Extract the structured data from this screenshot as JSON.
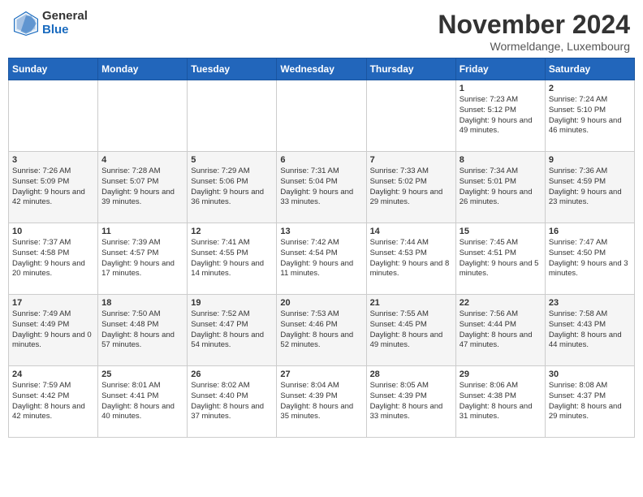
{
  "logo": {
    "general": "General",
    "blue": "Blue"
  },
  "header": {
    "month": "November 2024",
    "location": "Wormeldange, Luxembourg"
  },
  "days_of_week": [
    "Sunday",
    "Monday",
    "Tuesday",
    "Wednesday",
    "Thursday",
    "Friday",
    "Saturday"
  ],
  "weeks": [
    [
      {
        "day": "",
        "info": ""
      },
      {
        "day": "",
        "info": ""
      },
      {
        "day": "",
        "info": ""
      },
      {
        "day": "",
        "info": ""
      },
      {
        "day": "",
        "info": ""
      },
      {
        "day": "1",
        "info": "Sunrise: 7:23 AM\nSunset: 5:12 PM\nDaylight: 9 hours\nand 49 minutes."
      },
      {
        "day": "2",
        "info": "Sunrise: 7:24 AM\nSunset: 5:10 PM\nDaylight: 9 hours\nand 46 minutes."
      }
    ],
    [
      {
        "day": "3",
        "info": "Sunrise: 7:26 AM\nSunset: 5:09 PM\nDaylight: 9 hours\nand 42 minutes."
      },
      {
        "day": "4",
        "info": "Sunrise: 7:28 AM\nSunset: 5:07 PM\nDaylight: 9 hours\nand 39 minutes."
      },
      {
        "day": "5",
        "info": "Sunrise: 7:29 AM\nSunset: 5:06 PM\nDaylight: 9 hours\nand 36 minutes."
      },
      {
        "day": "6",
        "info": "Sunrise: 7:31 AM\nSunset: 5:04 PM\nDaylight: 9 hours\nand 33 minutes."
      },
      {
        "day": "7",
        "info": "Sunrise: 7:33 AM\nSunset: 5:02 PM\nDaylight: 9 hours\nand 29 minutes."
      },
      {
        "day": "8",
        "info": "Sunrise: 7:34 AM\nSunset: 5:01 PM\nDaylight: 9 hours\nand 26 minutes."
      },
      {
        "day": "9",
        "info": "Sunrise: 7:36 AM\nSunset: 4:59 PM\nDaylight: 9 hours\nand 23 minutes."
      }
    ],
    [
      {
        "day": "10",
        "info": "Sunrise: 7:37 AM\nSunset: 4:58 PM\nDaylight: 9 hours\nand 20 minutes."
      },
      {
        "day": "11",
        "info": "Sunrise: 7:39 AM\nSunset: 4:57 PM\nDaylight: 9 hours\nand 17 minutes."
      },
      {
        "day": "12",
        "info": "Sunrise: 7:41 AM\nSunset: 4:55 PM\nDaylight: 9 hours\nand 14 minutes."
      },
      {
        "day": "13",
        "info": "Sunrise: 7:42 AM\nSunset: 4:54 PM\nDaylight: 9 hours\nand 11 minutes."
      },
      {
        "day": "14",
        "info": "Sunrise: 7:44 AM\nSunset: 4:53 PM\nDaylight: 9 hours\nand 8 minutes."
      },
      {
        "day": "15",
        "info": "Sunrise: 7:45 AM\nSunset: 4:51 PM\nDaylight: 9 hours\nand 5 minutes."
      },
      {
        "day": "16",
        "info": "Sunrise: 7:47 AM\nSunset: 4:50 PM\nDaylight: 9 hours\nand 3 minutes."
      }
    ],
    [
      {
        "day": "17",
        "info": "Sunrise: 7:49 AM\nSunset: 4:49 PM\nDaylight: 9 hours\nand 0 minutes."
      },
      {
        "day": "18",
        "info": "Sunrise: 7:50 AM\nSunset: 4:48 PM\nDaylight: 8 hours\nand 57 minutes."
      },
      {
        "day": "19",
        "info": "Sunrise: 7:52 AM\nSunset: 4:47 PM\nDaylight: 8 hours\nand 54 minutes."
      },
      {
        "day": "20",
        "info": "Sunrise: 7:53 AM\nSunset: 4:46 PM\nDaylight: 8 hours\nand 52 minutes."
      },
      {
        "day": "21",
        "info": "Sunrise: 7:55 AM\nSunset: 4:45 PM\nDaylight: 8 hours\nand 49 minutes."
      },
      {
        "day": "22",
        "info": "Sunrise: 7:56 AM\nSunset: 4:44 PM\nDaylight: 8 hours\nand 47 minutes."
      },
      {
        "day": "23",
        "info": "Sunrise: 7:58 AM\nSunset: 4:43 PM\nDaylight: 8 hours\nand 44 minutes."
      }
    ],
    [
      {
        "day": "24",
        "info": "Sunrise: 7:59 AM\nSunset: 4:42 PM\nDaylight: 8 hours\nand 42 minutes."
      },
      {
        "day": "25",
        "info": "Sunrise: 8:01 AM\nSunset: 4:41 PM\nDaylight: 8 hours\nand 40 minutes."
      },
      {
        "day": "26",
        "info": "Sunrise: 8:02 AM\nSunset: 4:40 PM\nDaylight: 8 hours\nand 37 minutes."
      },
      {
        "day": "27",
        "info": "Sunrise: 8:04 AM\nSunset: 4:39 PM\nDaylight: 8 hours\nand 35 minutes."
      },
      {
        "day": "28",
        "info": "Sunrise: 8:05 AM\nSunset: 4:39 PM\nDaylight: 8 hours\nand 33 minutes."
      },
      {
        "day": "29",
        "info": "Sunrise: 8:06 AM\nSunset: 4:38 PM\nDaylight: 8 hours\nand 31 minutes."
      },
      {
        "day": "30",
        "info": "Sunrise: 8:08 AM\nSunset: 4:37 PM\nDaylight: 8 hours\nand 29 minutes."
      }
    ]
  ]
}
